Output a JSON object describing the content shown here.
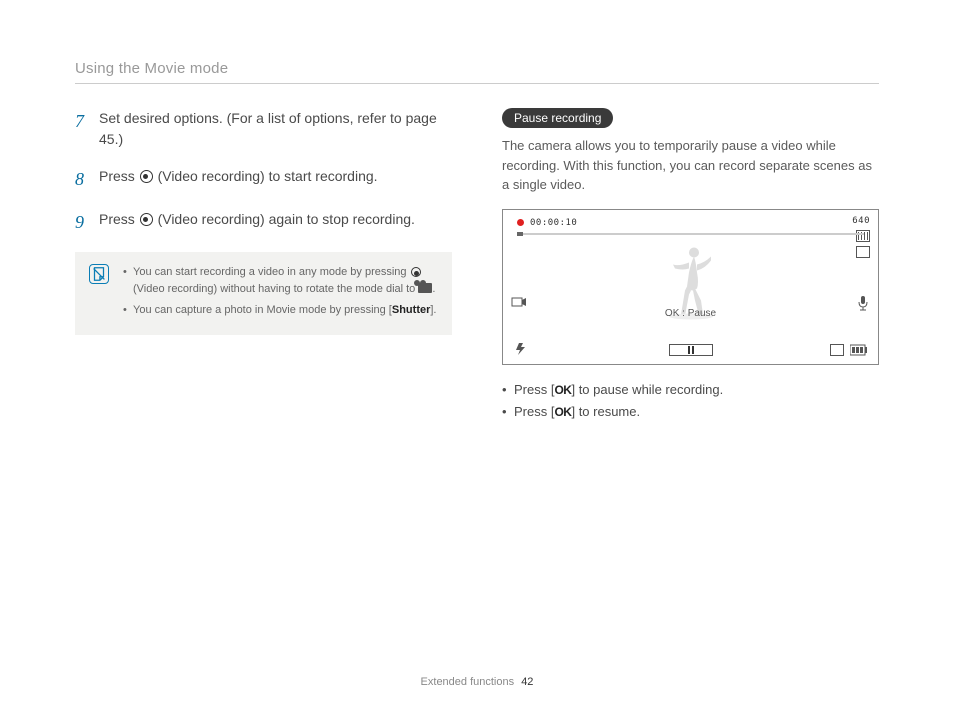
{
  "header": {
    "title": "Using the Movie mode"
  },
  "steps": [
    {
      "num": "7",
      "text_a": "Set desired options. (For a list of options, refer to page 45.)"
    },
    {
      "num": "8",
      "text_a": "Press ",
      "text_b": " (Video recording) to start recording."
    },
    {
      "num": "9",
      "text_a": "Press ",
      "text_b": " (Video recording) again to stop recording."
    }
  ],
  "note": {
    "line1_a": "You can start recording a video in any mode by pressing ",
    "line1_b": " (Video recording) without having to rotate the mode dial to ",
    "line1_c": ".",
    "line2_a": "You can capture a photo in Movie mode by pressing [",
    "line2_b": "Shutter",
    "line2_c": "]."
  },
  "right": {
    "pill": "Pause recording",
    "intro": "The camera allows you to temporarily pause a video while recording. With this function, you can record separate scenes as a single video.",
    "screen": {
      "timer": "00:00:10",
      "res": "640",
      "ok_label": "OK : Pause"
    },
    "bullets": {
      "b1_a": "Press [",
      "b1_ok": "OK",
      "b1_b": "] to pause while recording.",
      "b2_a": "Press [",
      "b2_ok": "OK",
      "b2_b": "] to resume."
    }
  },
  "footer": {
    "section": "Extended functions",
    "page": "42"
  }
}
